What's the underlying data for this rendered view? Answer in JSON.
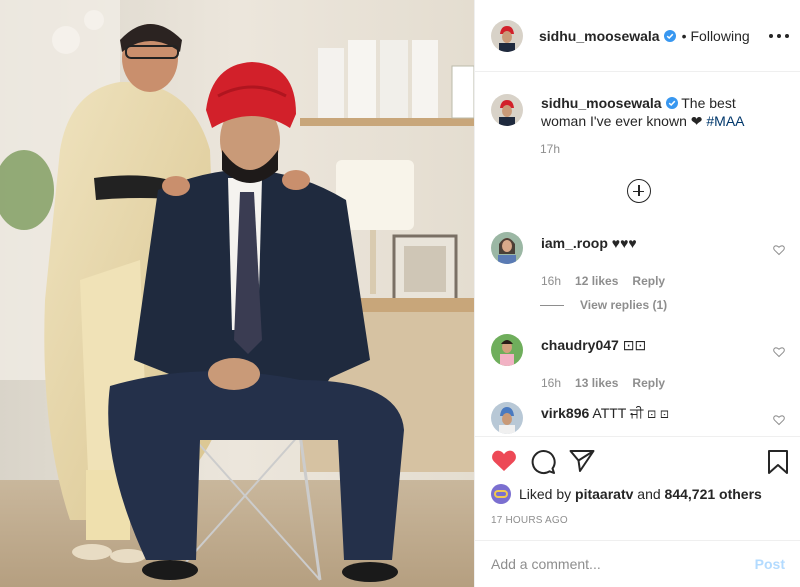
{
  "post": {
    "photo_alt": "Photo",
    "author": "sidhu_moosewala",
    "separator": "•",
    "following_label": "Following",
    "more_icon": "more-options-icon"
  },
  "caption": {
    "username": "sidhu_moosewala",
    "text": "The best woman I've ever known ❤",
    "hashtag": "#MAA",
    "time": "17h"
  },
  "comments": [
    {
      "username": "iam_.roop",
      "text": "♥♥♥",
      "time": "16h",
      "likes": "12 likes",
      "reply": "Reply"
    },
    {
      "username": "chaudry047",
      "text": "⊡⊡",
      "time": "16h",
      "likes": "13 likes",
      "reply": "Reply"
    },
    {
      "username": "virk896",
      "text": "ATTT ਜੀ ⊡ ⊡"
    }
  ],
  "view_replies": "View replies (1)",
  "liked_by": {
    "prefix": "Liked by ",
    "user": "pitaaratv",
    "middle": " and ",
    "count": "844,721 others"
  },
  "timestamp": "17 HOURS AGO",
  "add_comment": {
    "placeholder": "Add a comment...",
    "post_label": "Post"
  },
  "colors": {
    "like_red": "#ed4956",
    "hashtag": "#00376b",
    "verified_blue": "#3897f0",
    "post_disabled": "#b3dbff"
  }
}
